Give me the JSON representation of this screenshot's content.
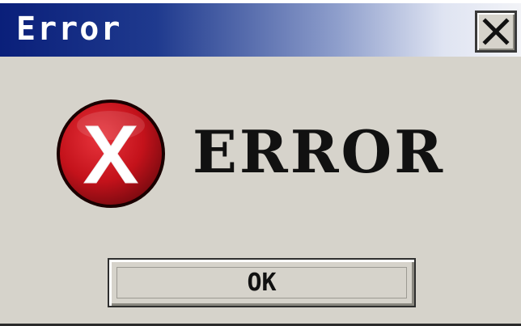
{
  "window": {
    "title": "Error",
    "close_label": "close"
  },
  "dialog": {
    "icon": "error-x-circle-icon",
    "heading": "ERROR",
    "ok_label": "OK"
  },
  "colors": {
    "titlebar_start": "#0a1f7a",
    "titlebar_end": "#f2f3f7",
    "dialog_background": "#d6d3cb",
    "icon_red": "#c4121b",
    "text": "#111111"
  }
}
